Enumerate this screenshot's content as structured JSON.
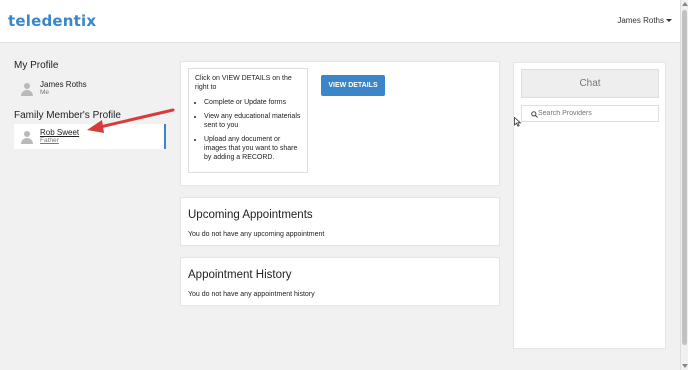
{
  "header": {
    "logo_text": "teledentix",
    "user_name": "James Roths"
  },
  "sidebar": {
    "my_profile_heading": "My Profile",
    "my_profile": {
      "name": "James Roths",
      "relation": "Me"
    },
    "family_heading": "Family Member's Profile",
    "family_members": [
      {
        "name": "Rob Sweet",
        "relation": "Father"
      }
    ]
  },
  "details_card": {
    "intro": "Click on VIEW DETAILS on the right to",
    "bullets": [
      "Complete or Update forms",
      "View any educational materials sent to you",
      "Upload any document or images that you want to share by adding a RECORD."
    ],
    "button_label": "VIEW DETAILS"
  },
  "upcoming": {
    "title": "Upcoming Appointments",
    "message": "You do not have any upcoming appointment"
  },
  "history": {
    "title": "Appointment History",
    "message": "You do not have any appointment history"
  },
  "chat": {
    "button_label": "Chat",
    "search_placeholder": "Search Providers"
  },
  "colors": {
    "accent": "#3a86c8",
    "annotation_arrow": "#d93b3b",
    "background": "#f1f1f1"
  }
}
